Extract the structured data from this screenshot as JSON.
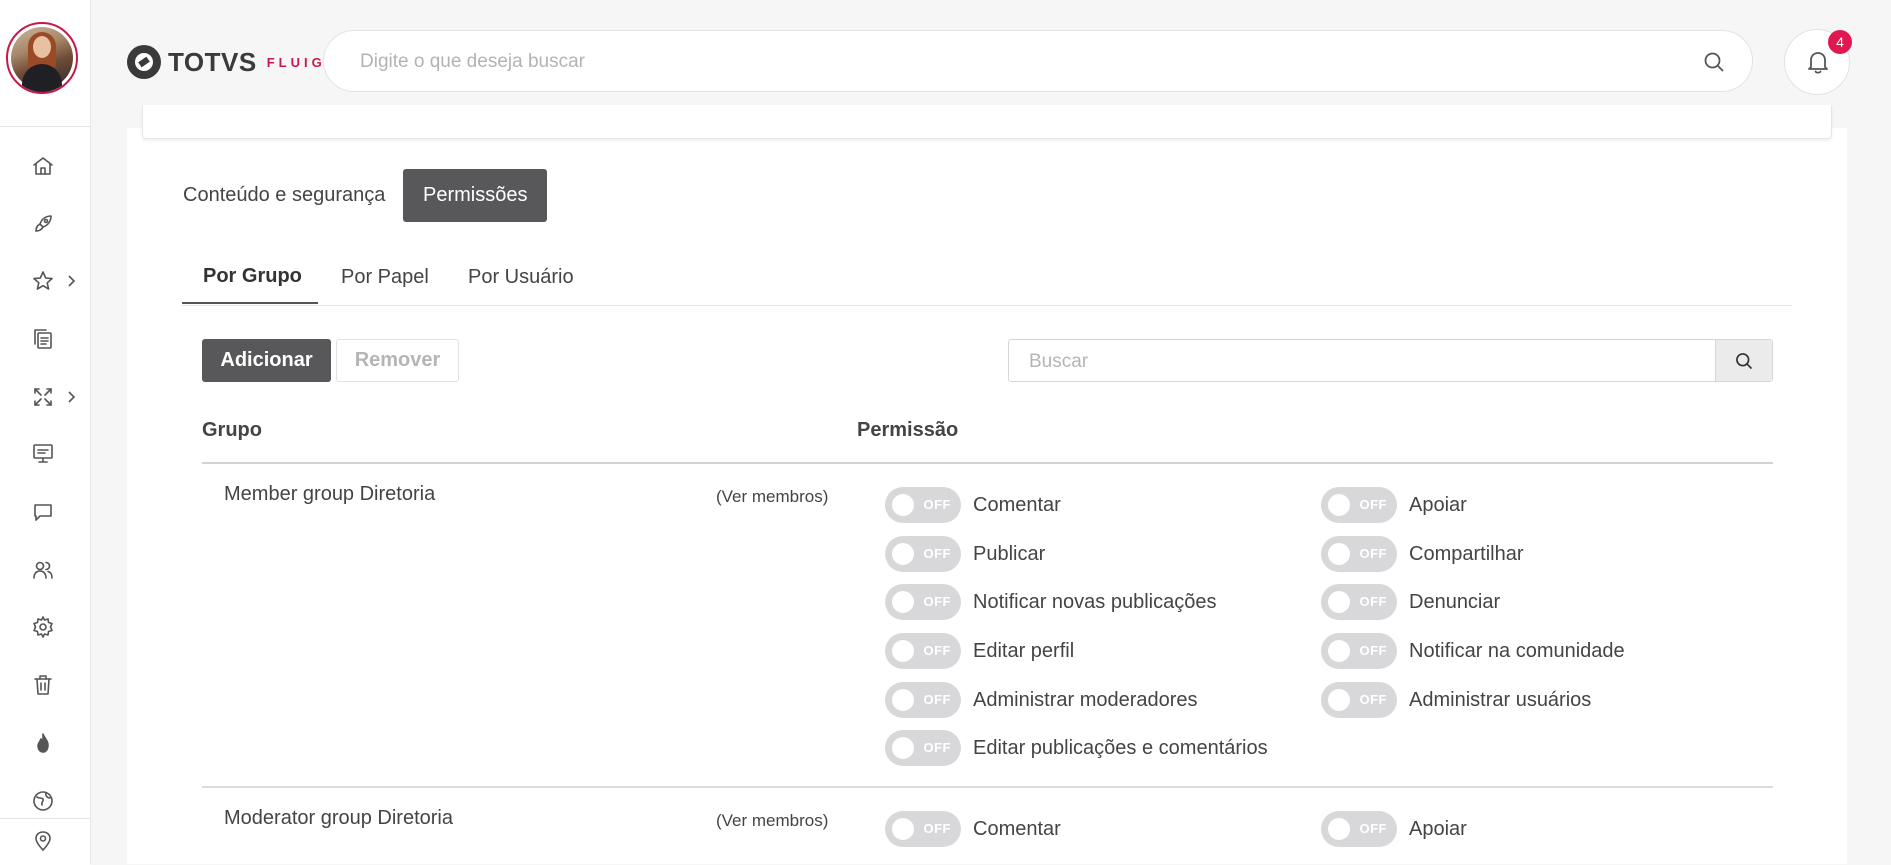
{
  "header": {
    "logo_text": "TOTVS",
    "logo_sub": "FLUIG",
    "search_placeholder": "Digite o que deseja buscar",
    "notification_count": "4"
  },
  "sidebar": {
    "items": [
      "home-icon",
      "rocket-icon",
      "star-icon",
      "documents-icon",
      "workflow-icon",
      "presentation-icon",
      "chat-icon",
      "users-icon",
      "gear-icon",
      "trash-icon",
      "fire-icon",
      "globe-icon",
      "location-icon"
    ]
  },
  "tabs": {
    "top": [
      "Conteúdo e segurança",
      "Permissões"
    ],
    "sub": [
      "Por Grupo",
      "Por Papel",
      "Por Usuário"
    ]
  },
  "toolbar": {
    "add_label": "Adicionar",
    "remove_label": "Remover",
    "search_placeholder": "Buscar"
  },
  "table": {
    "col_group": "Grupo",
    "col_permission": "Permissão",
    "toggle_off": "OFF",
    "rows": [
      {
        "group": "Member group Diretoria",
        "members_link": "(Ver membros)",
        "left": [
          "Comentar",
          "Publicar",
          "Notificar novas publicações",
          "Editar perfil",
          "Administrar moderadores",
          "Editar publicações e comentários"
        ],
        "right": [
          "Apoiar",
          "Compartilhar",
          "Denunciar",
          "Notificar na comunidade",
          "Administrar usuários"
        ]
      },
      {
        "group": "Moderator group Diretoria",
        "members_link": "(Ver membros)",
        "left": [
          "Comentar"
        ],
        "right": [
          "Apoiar"
        ]
      }
    ]
  },
  "colors": {
    "accent": "#c8184a",
    "badge": "#e1174f",
    "active_tab": "#58585a"
  }
}
